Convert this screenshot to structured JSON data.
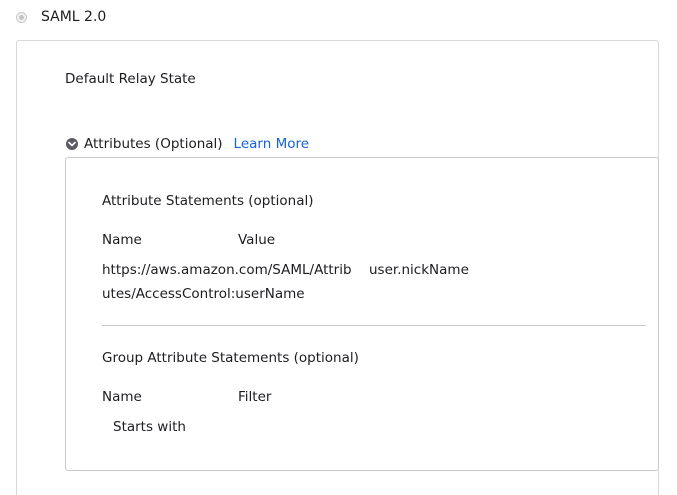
{
  "saml": {
    "label": "SAML 2.0"
  },
  "relay": {
    "label": "Default Relay State"
  },
  "attributes": {
    "toggle_label": "Attributes (Optional)",
    "learn_more": "Learn More"
  },
  "attribute_statements": {
    "title": "Attribute Statements (optional)",
    "columns": [
      "Name",
      "Value"
    ],
    "rows": [
      {
        "name_line1": "https://aws.amazon.com/SAML/Attrib",
        "name_line2": "utes/AccessControl:userName",
        "value": "user.nickName"
      }
    ]
  },
  "group_attribute_statements": {
    "title": "Group Attribute Statements (optional)",
    "columns": [
      "Name",
      "Filter"
    ],
    "rows": [
      {
        "name": "",
        "filter": "Starts with"
      }
    ]
  }
}
